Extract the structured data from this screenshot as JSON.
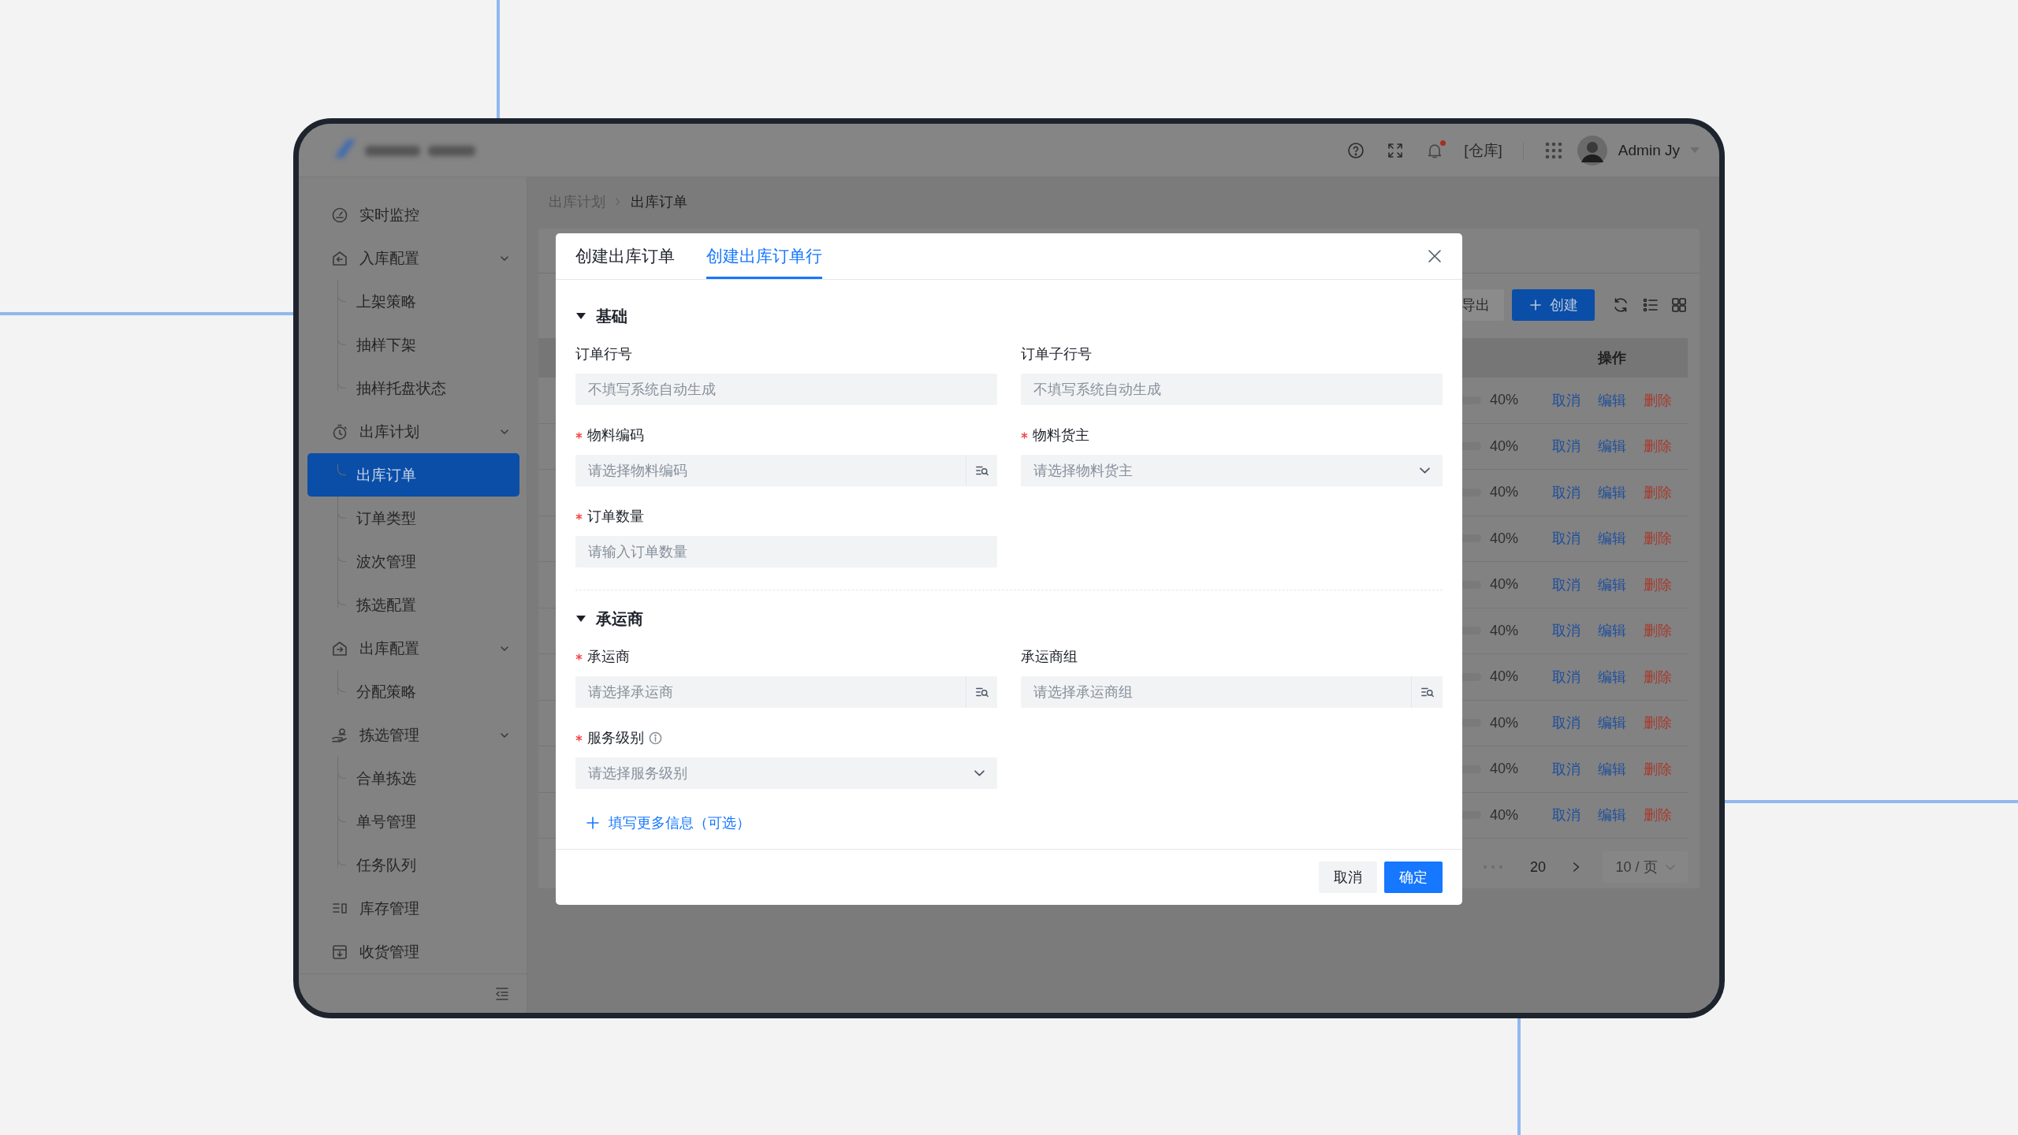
{
  "header": {
    "notification_unread": true,
    "location": "[仓库]",
    "user_name": "Admin Jy"
  },
  "sidebar": {
    "items": [
      {
        "label": "实时监控",
        "selected": false
      },
      {
        "label": "入库配置",
        "selected": false,
        "expanded": true,
        "children": [
          {
            "label": "上架策略",
            "selected": false
          },
          {
            "label": "抽样下架",
            "selected": false
          },
          {
            "label": "抽样托盘状态",
            "selected": false
          }
        ]
      },
      {
        "label": "出库计划",
        "selected": false,
        "expanded": true,
        "children": [
          {
            "label": "出库订单",
            "selected": true
          },
          {
            "label": "订单类型",
            "selected": false
          },
          {
            "label": "波次管理",
            "selected": false
          },
          {
            "label": "拣选配置",
            "selected": false
          }
        ]
      },
      {
        "label": "出库配置",
        "selected": false,
        "expanded": true,
        "children": [
          {
            "label": "分配策略",
            "selected": false
          }
        ]
      },
      {
        "label": "拣选管理",
        "selected": false,
        "expanded": true,
        "children": [
          {
            "label": "合单拣选",
            "selected": false
          },
          {
            "label": "单号管理",
            "selected": false
          },
          {
            "label": "任务队列",
            "selected": false
          }
        ]
      },
      {
        "label": "库存管理",
        "selected": false
      },
      {
        "label": "收货管理",
        "selected": false
      }
    ]
  },
  "breadcrumb": [
    {
      "label": "出库计划"
    },
    {
      "label": "出库订单"
    }
  ],
  "toolbar": {
    "buttons": [
      {
        "label": "导出",
        "kind": "secondary"
      },
      {
        "label": "创建",
        "kind": "primary"
      }
    ]
  },
  "table": {
    "columns": [
      "操作"
    ],
    "rows": [
      {
        "progress": "40%",
        "actions": [
          {
            "label": "取消",
            "kind": "link"
          },
          {
            "label": "编辑",
            "kind": "link"
          },
          {
            "label": "删除",
            "kind": "danger"
          }
        ]
      },
      {
        "progress": "40%",
        "actions": [
          {
            "label": "取消",
            "kind": "link"
          },
          {
            "label": "编辑",
            "kind": "link"
          },
          {
            "label": "删除",
            "kind": "danger"
          }
        ]
      },
      {
        "progress": "40%",
        "actions": [
          {
            "label": "取消",
            "kind": "link"
          },
          {
            "label": "编辑",
            "kind": "link"
          },
          {
            "label": "删除",
            "kind": "danger"
          }
        ]
      },
      {
        "progress": "40%",
        "actions": [
          {
            "label": "取消",
            "kind": "link"
          },
          {
            "label": "编辑",
            "kind": "link"
          },
          {
            "label": "删除",
            "kind": "danger"
          }
        ]
      },
      {
        "progress": "40%",
        "actions": [
          {
            "label": "取消",
            "kind": "link"
          },
          {
            "label": "编辑",
            "kind": "link"
          },
          {
            "label": "删除",
            "kind": "danger"
          }
        ]
      },
      {
        "progress": "40%",
        "actions": [
          {
            "label": "取消",
            "kind": "link"
          },
          {
            "label": "编辑",
            "kind": "link"
          },
          {
            "label": "删除",
            "kind": "danger"
          }
        ]
      },
      {
        "progress": "40%",
        "actions": [
          {
            "label": "取消",
            "kind": "link"
          },
          {
            "label": "编辑",
            "kind": "link"
          },
          {
            "label": "删除",
            "kind": "danger"
          }
        ]
      },
      {
        "progress": "40%",
        "actions": [
          {
            "label": "取消",
            "kind": "link"
          },
          {
            "label": "编辑",
            "kind": "link"
          },
          {
            "label": "删除",
            "kind": "danger"
          }
        ]
      },
      {
        "progress": "40%",
        "actions": [
          {
            "label": "取消",
            "kind": "link"
          },
          {
            "label": "编辑",
            "kind": "link"
          },
          {
            "label": "删除",
            "kind": "danger"
          }
        ]
      },
      {
        "progress": "40%",
        "actions": [
          {
            "label": "取消",
            "kind": "link"
          },
          {
            "label": "编辑",
            "kind": "link"
          },
          {
            "label": "删除",
            "kind": "danger"
          }
        ]
      }
    ]
  },
  "pagination": {
    "last_page": "20",
    "page_size": "10 / 页"
  },
  "modal": {
    "tabs": [
      {
        "label": "创建出库订单",
        "selected": false
      },
      {
        "label": "创建出库订单行",
        "selected": true
      }
    ],
    "sections": [
      {
        "title": "基础",
        "expanded": true,
        "fields": [
          {
            "label": "订单行号",
            "required": false,
            "kind": "text",
            "placeholder": "不填写系统自动生成"
          },
          {
            "label": "订单子行号",
            "required": false,
            "kind": "text",
            "placeholder": "不填写系统自动生成"
          },
          {
            "label": "物料编码",
            "required": true,
            "kind": "lookup",
            "placeholder": "请选择物料编码"
          },
          {
            "label": "物料货主",
            "required": true,
            "kind": "select",
            "placeholder": "请选择物料货主"
          },
          {
            "label": "订单数量",
            "required": true,
            "kind": "text",
            "placeholder": "请输入订单数量"
          }
        ]
      },
      {
        "title": "承运商",
        "expanded": true,
        "fields": [
          {
            "label": "承运商",
            "required": true,
            "kind": "lookup",
            "placeholder": "请选择承运商"
          },
          {
            "label": "承运商组",
            "required": false,
            "kind": "lookup",
            "placeholder": "请选择承运商组"
          },
          {
            "label": "服务级别",
            "required": true,
            "kind": "select",
            "info": true,
            "placeholder": "请选择服务级别"
          }
        ]
      }
    ],
    "more_link": "填写更多信息（可选）",
    "buttons": [
      {
        "label": "取消",
        "kind": "secondary"
      },
      {
        "label": "确定",
        "kind": "primary"
      }
    ]
  }
}
